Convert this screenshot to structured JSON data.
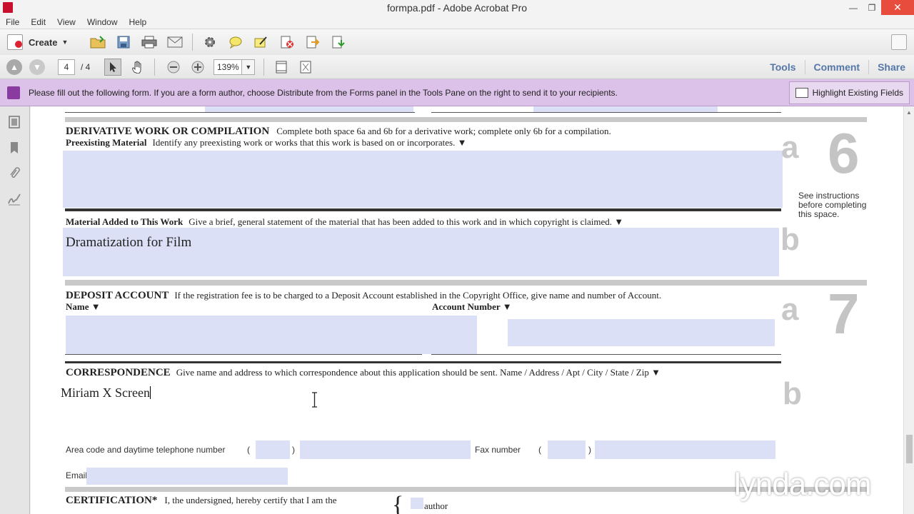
{
  "window": {
    "title": "formpa.pdf - Adobe Acrobat Pro"
  },
  "menu": {
    "items": [
      "File",
      "Edit",
      "View",
      "Window",
      "Help"
    ]
  },
  "toolbar": {
    "create_label": "Create"
  },
  "nav": {
    "page_current": "4",
    "page_total": "/ 4",
    "zoom": "139%"
  },
  "right_panel": {
    "tools": "Tools",
    "comment": "Comment",
    "share": "Share"
  },
  "notice": {
    "text": "Please fill out the following form. If you are a form author, choose Distribute from the Forms panel in the Tools Pane on the right to send it to your recipients.",
    "highlight_label": "Highlight Existing Fields"
  },
  "form": {
    "section6": {
      "heading": "DERIVATIVE WORK OR COMPILATION",
      "heading_desc": "Complete both space 6a and 6b for a derivative work; complete only 6b for a compilation.",
      "pre_label": "Preexisting Material",
      "pre_desc": "Identify any preexisting work or works that this work is based on or incorporates. ▼",
      "letter_a": "a",
      "number": "6",
      "instructions": "See instructions before completing this space.",
      "mat_label": "Material Added to This Work",
      "mat_desc": "Give a brief, general statement of the material that has been added to this work and in which copyright is claimed. ▼",
      "mat_value": "Dramatization for Film",
      "letter_b": "b"
    },
    "section7": {
      "heading": "DEPOSIT ACCOUNT",
      "heading_desc": "If the registration fee is to be charged to a Deposit Account established in the Copyright Office, give name and number of Account.",
      "name_label": "Name ▼",
      "account_label": "Account Number ▼",
      "letter_a": "a",
      "number": "7",
      "corr_heading": "CORRESPONDENCE",
      "corr_desc": "Give name and address to which correspondence about this application should be sent. Name / Address / Apt / City / State / Zip ▼",
      "corr_value": "Miriam X Screen",
      "letter_b": "b",
      "phone_label": "Area code and daytime telephone number",
      "fax_label": "Fax number",
      "paren_open": "(",
      "paren_close": ")",
      "email_label": "Email"
    },
    "section8": {
      "heading": "CERTIFICATION*",
      "desc": "I, the undersigned, hereby certify that I am the",
      "option_author": "author"
    }
  },
  "watermark": "lynda.com"
}
